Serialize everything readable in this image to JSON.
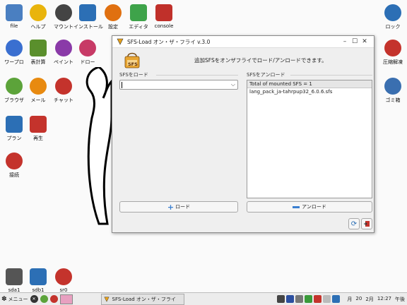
{
  "desktop": {
    "icons_left": [
      {
        "label": "file",
        "icon": "home-icon",
        "color": "#4a7fc1"
      },
      {
        "label": "ヘルプ",
        "icon": "lightbulb-icon",
        "color": "#e9b40c"
      },
      {
        "label": "マウント",
        "icon": "mount-toggle-icon",
        "color": "#444"
      },
      {
        "label": "インストール",
        "icon": "dropbox-icon",
        "color": "#2c6fb5"
      },
      {
        "label": "設定",
        "icon": "gear-icon",
        "color": "#e07010"
      },
      {
        "label": "エディタ",
        "icon": "edit-icon",
        "color": "#3ea34a"
      },
      {
        "label": "console",
        "icon": "terminal-icon",
        "color": "#c0302a"
      },
      {
        "label": "ワープロ",
        "icon": "writer-icon",
        "color": "#3a6fd0"
      },
      {
        "label": "表計算",
        "icon": "spreadsheet-icon",
        "color": "#5a8f2c"
      },
      {
        "label": "ペイント",
        "icon": "palette-icon",
        "color": "#8a3aa8"
      },
      {
        "label": "ドロー",
        "icon": "draw-icon",
        "color": "#c73a66"
      },
      {
        "label": "ブラウザ",
        "icon": "guitar-icon",
        "color": "#5ca33a"
      },
      {
        "label": "メール",
        "icon": "at-icon",
        "color": "#e88a10"
      },
      {
        "label": "チャット",
        "icon": "chat-icon",
        "color": "#c4332c"
      },
      {
        "label": "プラン",
        "icon": "calendar-icon",
        "color": "#2c6fb5"
      },
      {
        "label": "再生",
        "icon": "film-icon",
        "color": "#c4332c"
      },
      {
        "label": "接続",
        "icon": "network-icon",
        "color": "#c4332c"
      }
    ],
    "icons_right": [
      {
        "label": "ロック",
        "icon": "lock-icon",
        "color": "#2c6fb5"
      },
      {
        "label": "圧縮解凍",
        "icon": "archive-icon",
        "color": "#c4332c"
      },
      {
        "label": "ゴミ箱",
        "icon": "trash-icon",
        "color": "#3a6fb0"
      }
    ],
    "drives": [
      {
        "label": "sda1",
        "icon": "drive-icon",
        "color": "#555"
      },
      {
        "label": "sdb1",
        "icon": "usb-icon",
        "color": "#2c6fb5"
      },
      {
        "label": "sr0",
        "icon": "disc-icon",
        "color": "#c4332c"
      }
    ]
  },
  "window": {
    "title": "SFS-Load オン・ザ・フライ v.3.0",
    "logo_text": "SFS",
    "description": "追加SFSをオンザフライでロード/アンロードできます。",
    "load_panel": {
      "label": "SFSをロード",
      "combo_value": "",
      "button": "ロード"
    },
    "unload_panel": {
      "label": "SFSをアンロード",
      "list_header": "Total of mounted SFS = 1",
      "items": [
        "lang_pack_ja-tahrpup32_6.0.6.sfs"
      ],
      "button": "アンロード"
    }
  },
  "taskbar": {
    "menu_label": "メニュー",
    "task_label": "SFS-Load オン・ザ・フライ",
    "clock": {
      "month_label": "月",
      "day": "20",
      "month": "2月",
      "time": "12:27",
      "ampm": "午後"
    }
  }
}
